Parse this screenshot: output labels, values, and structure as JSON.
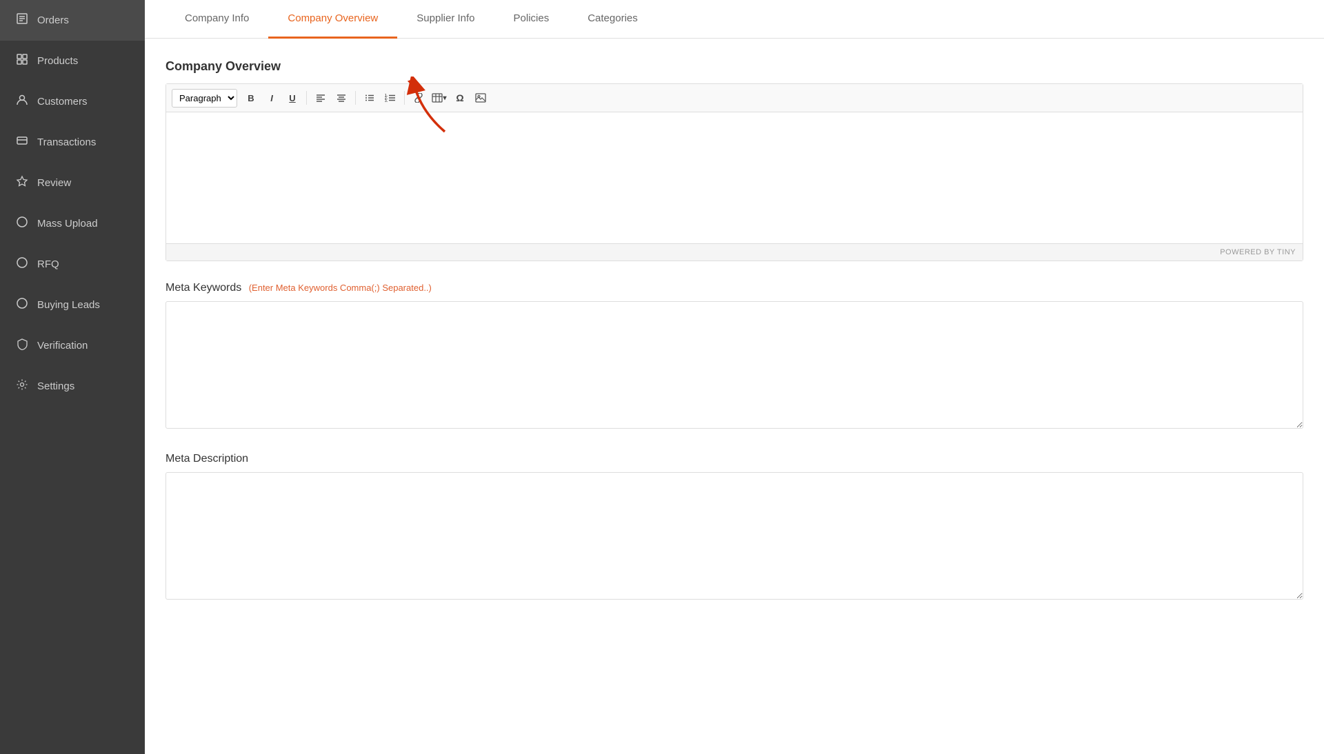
{
  "sidebar": {
    "items": [
      {
        "id": "orders",
        "label": "Orders",
        "icon": "☰",
        "active": false
      },
      {
        "id": "products",
        "label": "Products",
        "icon": "◻",
        "active": false
      },
      {
        "id": "customers",
        "label": "Customers",
        "icon": "👤",
        "active": false
      },
      {
        "id": "transactions",
        "label": "Transactions",
        "icon": "💳",
        "active": false
      },
      {
        "id": "review",
        "label": "Review",
        "icon": "★",
        "active": false
      },
      {
        "id": "mass-upload",
        "label": "Mass Upload",
        "icon": "○",
        "active": false
      },
      {
        "id": "rfq",
        "label": "RFQ",
        "icon": "○",
        "active": false
      },
      {
        "id": "buying-leads",
        "label": "Buying Leads",
        "icon": "○",
        "active": false
      },
      {
        "id": "verification",
        "label": "Verification",
        "icon": "🛡",
        "active": false
      },
      {
        "id": "settings",
        "label": "Settings",
        "icon": "⚙",
        "active": false
      }
    ]
  },
  "tabs": [
    {
      "id": "company-info",
      "label": "Company Info",
      "active": false
    },
    {
      "id": "company-overview",
      "label": "Company Overview",
      "active": true
    },
    {
      "id": "supplier-info",
      "label": "Supplier Info",
      "active": false
    },
    {
      "id": "policies",
      "label": "Policies",
      "active": false
    },
    {
      "id": "categories",
      "label": "Categories",
      "active": false
    }
  ],
  "page_title": "Company Overview",
  "editor": {
    "paragraph_label": "Paragraph",
    "footer_text": "POWERED BY TINY",
    "toolbar": {
      "bold": "B",
      "italic": "I",
      "underline": "U",
      "align_left": "≡",
      "align_center": "≡",
      "bullet_list": "≡",
      "numbered_list": "≡",
      "link": "🔗",
      "table": "⊞",
      "special_char": "Ω",
      "image": "🖼"
    }
  },
  "meta_keywords": {
    "label": "Meta Keywords",
    "hint": "(Enter Meta Keywords Comma(;) Separated..)",
    "value": "",
    "placeholder": ""
  },
  "meta_description": {
    "label": "Meta Description",
    "value": "",
    "placeholder": ""
  }
}
